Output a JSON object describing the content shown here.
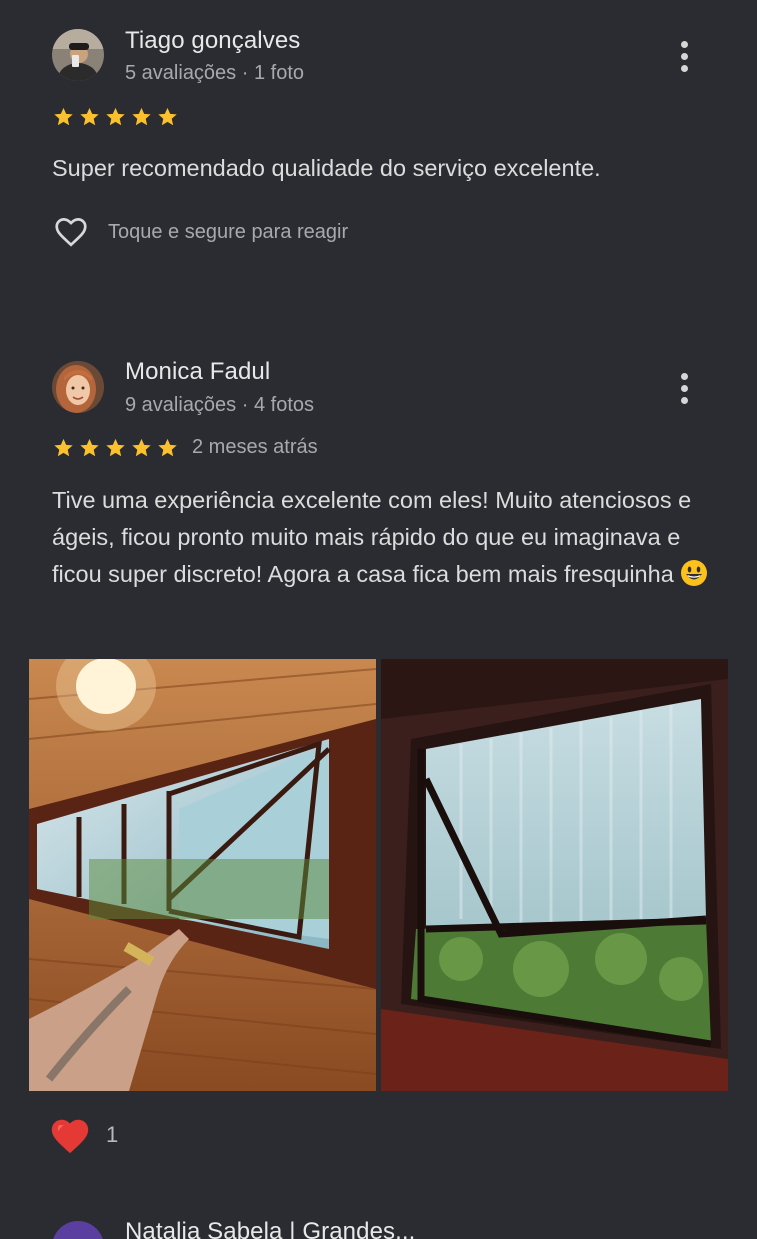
{
  "reviews": [
    {
      "author": "Tiago gonçalves",
      "meta": "5 avaliações · 1 foto",
      "rating": 5,
      "text": "Super recomendado qualidade do serviço excelente.",
      "react_label": "Toque e segure para reagir"
    },
    {
      "author": "Monica Fadul",
      "meta": "9 avaliações · 4 fotos",
      "rating": 5,
      "time_ago": "2 meses atrás",
      "text": "Tive uma experiência excelente com eles! Muito atenciosos e ágeis, ficou pronto muito mais rápido do que eu imaginava e ficou super discreto! Agora a casa fica bem mais fresquinha",
      "reaction_count": "1"
    },
    {
      "author": "Natalia Sabela | Grandes..."
    }
  ],
  "colors": {
    "background": "#2b2c31",
    "star": "#fbc02d",
    "heart_filled": "#e53935",
    "text_secondary": "#a8a9ad"
  }
}
